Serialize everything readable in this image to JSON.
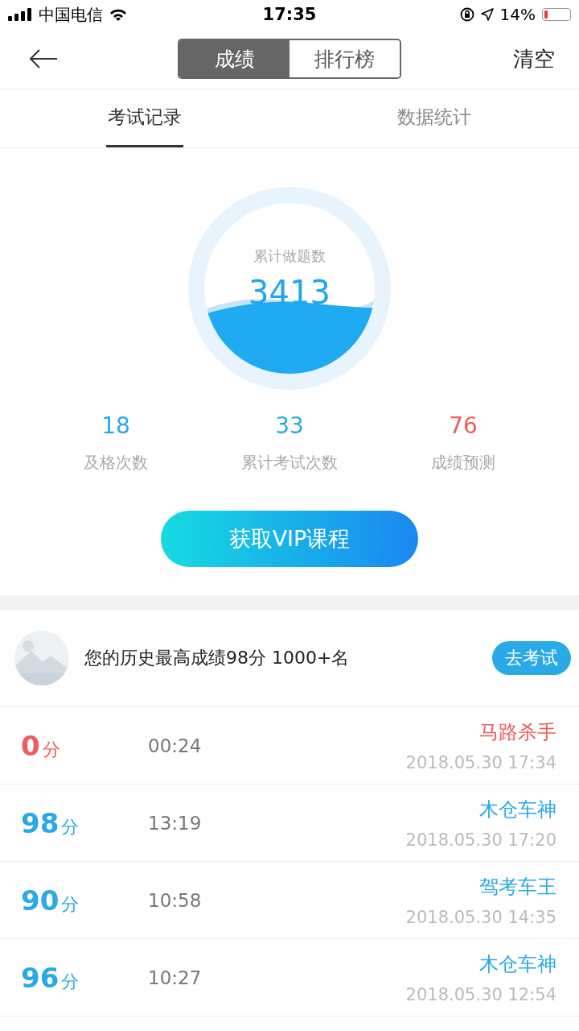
{
  "status_bar": {
    "carrier": "中国电信",
    "time": "17:35",
    "battery_text": "14%"
  },
  "nav": {
    "segments": [
      {
        "label": "成绩",
        "selected": true
      },
      {
        "label": "排行榜",
        "selected": false
      }
    ],
    "action": "清空"
  },
  "tabs": [
    {
      "label": "考试记录",
      "selected": true
    },
    {
      "label": "数据统计",
      "selected": false
    }
  ],
  "gauge": {
    "label": "累计做题数",
    "value": "3413"
  },
  "stats": [
    {
      "value": "18",
      "label": "及格次数",
      "color": "#29a9e6"
    },
    {
      "value": "33",
      "label": "累计考试次数",
      "color": "#29a9e6"
    },
    {
      "value": "76",
      "label": "成绩预测",
      "color": "#ee5c5c"
    }
  ],
  "vip_button": "获取VIP课程",
  "best": {
    "text": "您的历史最高成绩98分  1000+名",
    "button": "去考试"
  },
  "records": [
    {
      "score": "0",
      "unit": "分",
      "duration": "00:24",
      "title": "马路杀手",
      "date": "2018.05.30 17:34",
      "color": "#ee5c5c"
    },
    {
      "score": "98",
      "unit": "分",
      "duration": "13:19",
      "title": "木仓车神",
      "date": "2018.05.30 17:20",
      "color": "#29a9e6"
    },
    {
      "score": "90",
      "unit": "分",
      "duration": "10:58",
      "title": "驾考车王",
      "date": "2018.05.30 14:35",
      "color": "#29a9e6"
    },
    {
      "score": "96",
      "unit": "分",
      "duration": "10:27",
      "title": "木仓车神",
      "date": "2018.05.30 12:54",
      "color": "#29a9e6"
    }
  ]
}
